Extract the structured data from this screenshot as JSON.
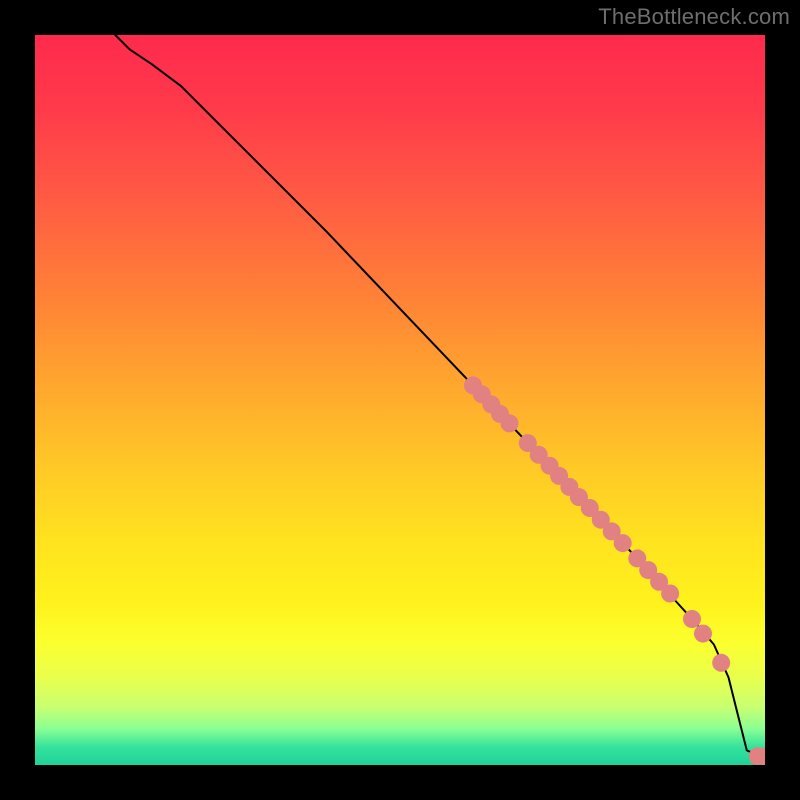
{
  "watermark": "TheBottleneck.com",
  "chart_data": {
    "type": "line",
    "title": "",
    "xlabel": "",
    "ylabel": "",
    "xlim": [
      0,
      100
    ],
    "ylim": [
      0,
      100
    ],
    "curve": {
      "x": [
        11,
        13,
        16,
        20,
        30,
        40,
        50,
        60,
        70,
        80,
        90,
        93,
        95,
        96,
        97.5,
        100
      ],
      "y": [
        100,
        98,
        96,
        93,
        83,
        73,
        62.5,
        52,
        41.5,
        31,
        20,
        16.5,
        12,
        8,
        2,
        1
      ]
    },
    "marker_series": {
      "name": "markers",
      "color": "#e18181",
      "points": [
        {
          "x": 60.0,
          "y": 52.0
        },
        {
          "x": 61.2,
          "y": 50.8
        },
        {
          "x": 62.5,
          "y": 49.4
        },
        {
          "x": 63.7,
          "y": 48.1
        },
        {
          "x": 65.0,
          "y": 46.8
        },
        {
          "x": 67.5,
          "y": 44.1
        },
        {
          "x": 69.0,
          "y": 42.5
        },
        {
          "x": 70.5,
          "y": 41.0
        },
        {
          "x": 71.8,
          "y": 39.6
        },
        {
          "x": 73.2,
          "y": 38.1
        },
        {
          "x": 74.5,
          "y": 36.7
        },
        {
          "x": 76.0,
          "y": 35.2
        },
        {
          "x": 77.5,
          "y": 33.6
        },
        {
          "x": 79.0,
          "y": 32.0
        },
        {
          "x": 80.5,
          "y": 30.4
        },
        {
          "x": 82.5,
          "y": 28.3
        },
        {
          "x": 84.0,
          "y": 26.7
        },
        {
          "x": 85.5,
          "y": 25.1
        },
        {
          "x": 87.0,
          "y": 23.5
        },
        {
          "x": 90.0,
          "y": 20.0
        },
        {
          "x": 91.5,
          "y": 18.0
        },
        {
          "x": 94.0,
          "y": 14.0
        },
        {
          "x": 99.0,
          "y": 1.2
        },
        {
          "x": 100.0,
          "y": 1.2
        }
      ]
    }
  }
}
